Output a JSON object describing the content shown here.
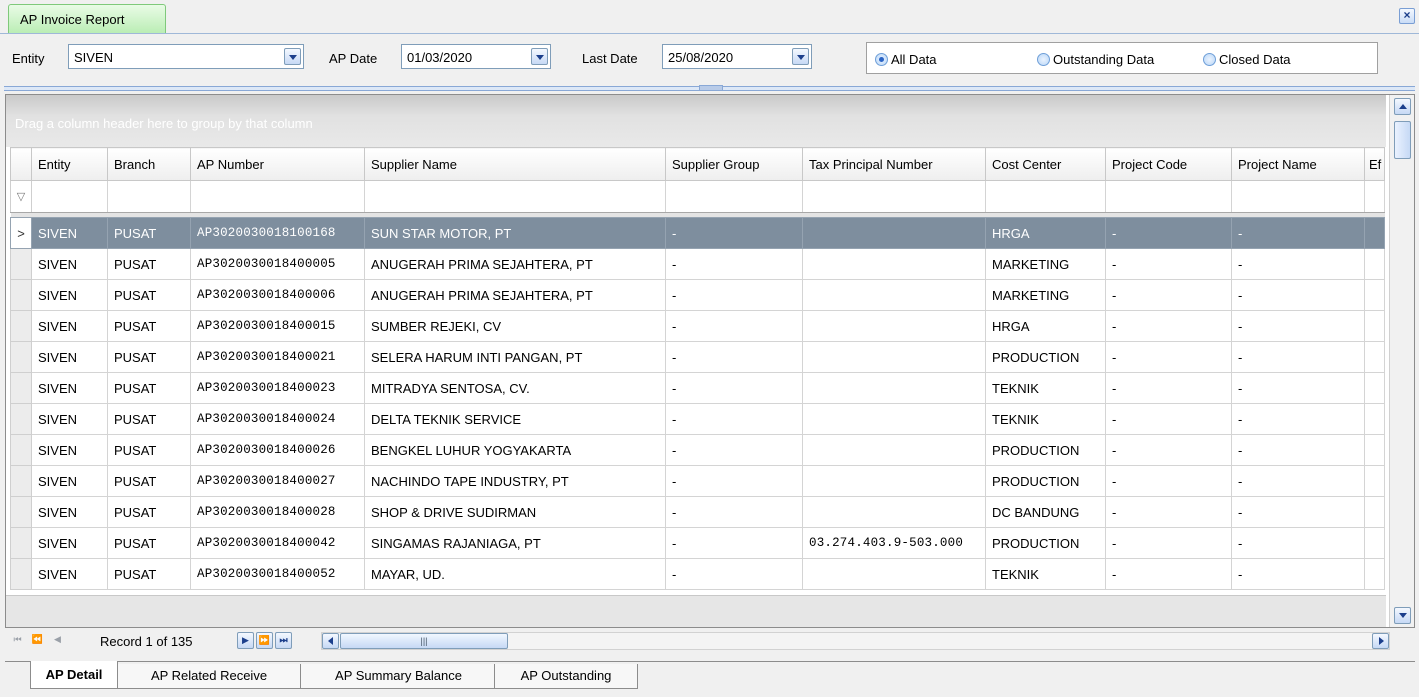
{
  "window": {
    "tab_title": "AP Invoice Report",
    "close_glyph": "×"
  },
  "filters": {
    "entity_label": "Entity",
    "entity_value": "SIVEN",
    "ap_date_label": "AP Date",
    "ap_date_value": "01/03/2020",
    "last_date_label": "Last Date",
    "last_date_value": "25/08/2020",
    "options": [
      "All Data",
      "Outstanding Data",
      "Closed Data"
    ],
    "selected_option": "All Data"
  },
  "grid": {
    "group_hint": "Drag a column header here to group by that column",
    "columns": [
      "Entity",
      "Branch",
      "AP Number",
      "Supplier Name",
      "Supplier Group",
      "Tax Principal Number",
      "Cost Center",
      "Project Code",
      "Project Name",
      "Ef"
    ],
    "rows": [
      [
        "SIVEN",
        "PUSAT",
        "AP3020030018100168",
        "SUN STAR MOTOR, PT",
        "-",
        "",
        "HRGA",
        "-",
        "-",
        ""
      ],
      [
        "SIVEN",
        "PUSAT",
        "AP3020030018400005",
        "ANUGERAH PRIMA SEJAHTERA, PT",
        "-",
        "",
        "MARKETING",
        "-",
        "-",
        ""
      ],
      [
        "SIVEN",
        "PUSAT",
        "AP3020030018400006",
        "ANUGERAH PRIMA SEJAHTERA, PT",
        "-",
        "",
        "MARKETING",
        "-",
        "-",
        ""
      ],
      [
        "SIVEN",
        "PUSAT",
        "AP3020030018400015",
        "SUMBER REJEKI, CV",
        "-",
        "",
        "HRGA",
        "-",
        "-",
        ""
      ],
      [
        "SIVEN",
        "PUSAT",
        "AP3020030018400021",
        "SELERA HARUM INTI PANGAN, PT",
        "-",
        "",
        "PRODUCTION",
        "-",
        "-",
        ""
      ],
      [
        "SIVEN",
        "PUSAT",
        "AP3020030018400023",
        "MITRADYA SENTOSA, CV.",
        "-",
        "",
        "TEKNIK",
        "-",
        "-",
        ""
      ],
      [
        "SIVEN",
        "PUSAT",
        "AP3020030018400024",
        "DELTA TEKNIK SERVICE",
        "-",
        "",
        "TEKNIK",
        "-",
        "-",
        ""
      ],
      [
        "SIVEN",
        "PUSAT",
        "AP3020030018400026",
        "BENGKEL LUHUR YOGYAKARTA",
        "-",
        "",
        "PRODUCTION",
        "-",
        "-",
        ""
      ],
      [
        "SIVEN",
        "PUSAT",
        "AP3020030018400027",
        "NACHINDO TAPE INDUSTRY, PT",
        "-",
        "",
        "PRODUCTION",
        "-",
        "-",
        ""
      ],
      [
        "SIVEN",
        "PUSAT",
        "AP3020030018400028",
        "SHOP & DRIVE SUDIRMAN",
        "-",
        "",
        "DC BANDUNG",
        "-",
        "-",
        ""
      ],
      [
        "SIVEN",
        "PUSAT",
        "AP3020030018400042",
        "SINGAMAS RAJANIAGA, PT",
        "-",
        "03.274.403.9-503.000",
        "PRODUCTION",
        "-",
        "-",
        ""
      ],
      [
        "SIVEN",
        "PUSAT",
        "AP3020030018400052",
        "MAYAR, UD.",
        "-",
        "",
        "TEKNIK",
        "-",
        "-",
        ""
      ]
    ],
    "selected_row": 0,
    "row_indicator": ">"
  },
  "navigator": {
    "record_text": "Record 1 of 135"
  },
  "bottom_tabs": [
    "AP Detail",
    "AP Related Receive",
    "AP Summary Balance",
    "AP Outstanding"
  ],
  "active_tab": "AP Detail",
  "colors": {
    "tab_green": "#b9edb3",
    "selected_row": "#7e8e9e",
    "accent_blue": "#1c3f8c"
  }
}
